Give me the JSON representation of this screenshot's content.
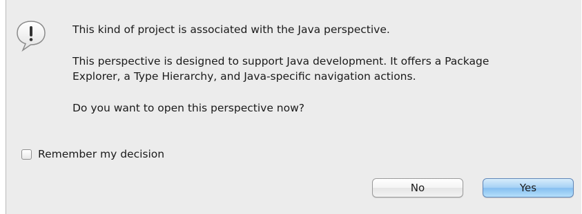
{
  "dialog": {
    "icon": "alert-icon",
    "message_line1": "This kind of project is associated with the Java perspective.",
    "message_paragraph2_line1": "This perspective is designed to support Java development. It offers a Package",
    "message_paragraph2_line2": "Explorer, a Type Hierarchy, and Java-specific navigation actions.",
    "message_question": "Do you want to open this perspective now?",
    "remember_label": "Remember my decision",
    "remember_checked": false,
    "no_label": "No",
    "yes_label": "Yes"
  },
  "colors": {
    "dialog_background": "#ececec",
    "default_button": "#86bff0"
  }
}
